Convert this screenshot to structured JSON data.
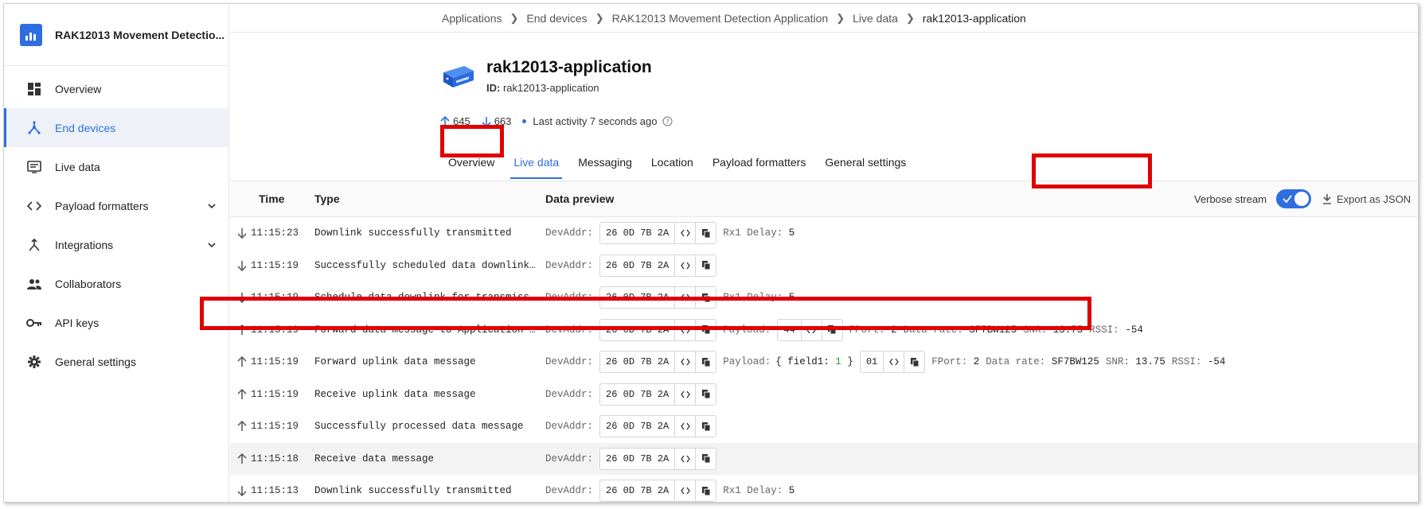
{
  "sidebar": {
    "app_title": "RAK12013 Movement Detectio...",
    "items": [
      {
        "label": "Overview",
        "icon": "dashboard-icon",
        "active": false,
        "expandable": false
      },
      {
        "label": "End devices",
        "icon": "end-devices-icon",
        "active": true,
        "expandable": false
      },
      {
        "label": "Live data",
        "icon": "live-data-icon",
        "active": false,
        "expandable": false
      },
      {
        "label": "Payload formatters",
        "icon": "code-icon",
        "active": false,
        "expandable": true
      },
      {
        "label": "Integrations",
        "icon": "integrations-icon",
        "active": false,
        "expandable": true
      },
      {
        "label": "Collaborators",
        "icon": "collaborators-icon",
        "active": false,
        "expandable": false
      },
      {
        "label": "API keys",
        "icon": "key-icon",
        "active": false,
        "expandable": false
      },
      {
        "label": "General settings",
        "icon": "gear-icon",
        "active": false,
        "expandable": false
      }
    ]
  },
  "breadcrumb": [
    "Applications",
    "End devices",
    "RAK12013 Movement Detection Application",
    "Live data",
    "rak12013-application"
  ],
  "device": {
    "name": "rak12013-application",
    "id_label": "ID:",
    "id_value": "rak12013-application",
    "uplinks": "645",
    "downlinks": "663",
    "last_activity": "Last activity 7 seconds ago"
  },
  "tabs": [
    {
      "label": "Overview",
      "active": false
    },
    {
      "label": "Live data",
      "active": true
    },
    {
      "label": "Messaging",
      "active": false
    },
    {
      "label": "Location",
      "active": false
    },
    {
      "label": "Payload formatters",
      "active": false
    },
    {
      "label": "General settings",
      "active": false
    }
  ],
  "table": {
    "headers": {
      "time": "Time",
      "type": "Type",
      "preview": "Data preview"
    },
    "verbose_label": "Verbose stream",
    "verbose_on": true,
    "export_label": "Export as JSON",
    "rows": [
      {
        "dir": "down",
        "time": "11:15:23",
        "type": "Downlink successfully transmitted",
        "devaddr": "26 0D 7B 2A",
        "extra": [
          {
            "k": "Rx1 Delay:",
            "v": "5"
          }
        ]
      },
      {
        "dir": "down",
        "time": "11:15:19",
        "type": "Successfully scheduled data downlink for transmission",
        "devaddr": "26 0D 7B 2A",
        "extra": []
      },
      {
        "dir": "down",
        "time": "11:15:19",
        "type": "Schedule data downlink for transmission",
        "devaddr": "26 0D 7B 2A",
        "extra": [
          {
            "k": "Rx1 Delay:",
            "v": "5"
          }
        ]
      },
      {
        "dir": "up",
        "time": "11:15:19",
        "type": "Forward data message to Application Server",
        "devaddr": "26 0D 7B 2A",
        "payload_hex": "44",
        "extra": [
          {
            "k": "FPort:",
            "v": "2"
          },
          {
            "k": "Data rate:",
            "v": "SF7BW125"
          },
          {
            "k": "SNR:",
            "v": "13.75"
          },
          {
            "k": "RSSI:",
            "v": "-54"
          }
        ]
      },
      {
        "dir": "up",
        "time": "11:15:19",
        "type": "Forward uplink data message",
        "devaddr": "26 0D 7B 2A",
        "decoded": {
          "key": "field1:",
          "value": "1"
        },
        "payload_hex": "01",
        "extra": [
          {
            "k": "FPort:",
            "v": "2"
          },
          {
            "k": "Data rate:",
            "v": "SF7BW125"
          },
          {
            "k": "SNR:",
            "v": "13.75"
          },
          {
            "k": "RSSI:",
            "v": "-54"
          }
        ]
      },
      {
        "dir": "up",
        "time": "11:15:19",
        "type": "Receive uplink data message",
        "devaddr": "26 0D 7B 2A",
        "extra": []
      },
      {
        "dir": "up",
        "time": "11:15:19",
        "type": "Successfully processed data message",
        "devaddr": "26 0D 7B 2A",
        "extra": []
      },
      {
        "dir": "up",
        "time": "11:15:18",
        "type": "Receive data message",
        "devaddr": "26 0D 7B 2A",
        "extra": [],
        "shaded": true
      },
      {
        "dir": "down",
        "time": "11:15:13",
        "type": "Downlink successfully transmitted",
        "devaddr": "26 0D 7B 2A",
        "extra": [
          {
            "k": "Rx1 Delay:",
            "v": "5"
          }
        ]
      }
    ],
    "labels": {
      "devaddr": "DevAddr:",
      "payload": "Payload:"
    }
  },
  "colors": {
    "accent": "#2f6ee0",
    "highlight": "#e00000",
    "number": "#2e9a2e"
  }
}
